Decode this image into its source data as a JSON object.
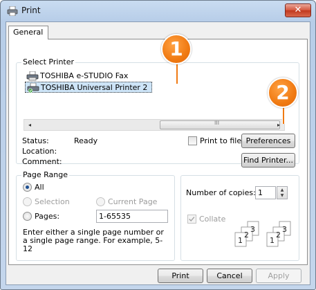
{
  "window": {
    "title": "Print",
    "close_glyph": "✕"
  },
  "tabs": [
    {
      "label": "General"
    }
  ],
  "select_printer": {
    "label": "Select Printer",
    "printers": [
      {
        "name": "TOSHIBA e-STUDIO Fax",
        "icon": "fax-printer-icon"
      },
      {
        "name": "TOSHIBA Universal Printer 2",
        "icon": "default-printer-icon"
      }
    ],
    "scroll_left": "◂",
    "scroll_right": "▸",
    "thumb_grip": "III",
    "status_label": "Status:",
    "status_value": "Ready",
    "location_label": "Location:",
    "location_value": "",
    "comment_label": "Comment:",
    "comment_value": "",
    "print_to_file": "Print to file",
    "preferences_button": "Preferences",
    "find_printer_button": "Find Printer..."
  },
  "page_range": {
    "label": "Page Range",
    "all": "All",
    "selection": "Selection",
    "current_page": "Current Page",
    "pages": "Pages:",
    "pages_value": "1-65535",
    "hint": "Enter either a single page number or a single page range.  For example, 5-12"
  },
  "copies": {
    "label": "Number of copies:",
    "value": "1",
    "collate": "Collate",
    "collate_digits": [
      "1",
      "2",
      "3"
    ]
  },
  "footer": {
    "print": "Print",
    "cancel": "Cancel",
    "apply": "Apply"
  },
  "callouts": {
    "one": "1",
    "two": "2"
  },
  "colors": {
    "accent": "#f07a12",
    "selection": "#cde4f7"
  }
}
